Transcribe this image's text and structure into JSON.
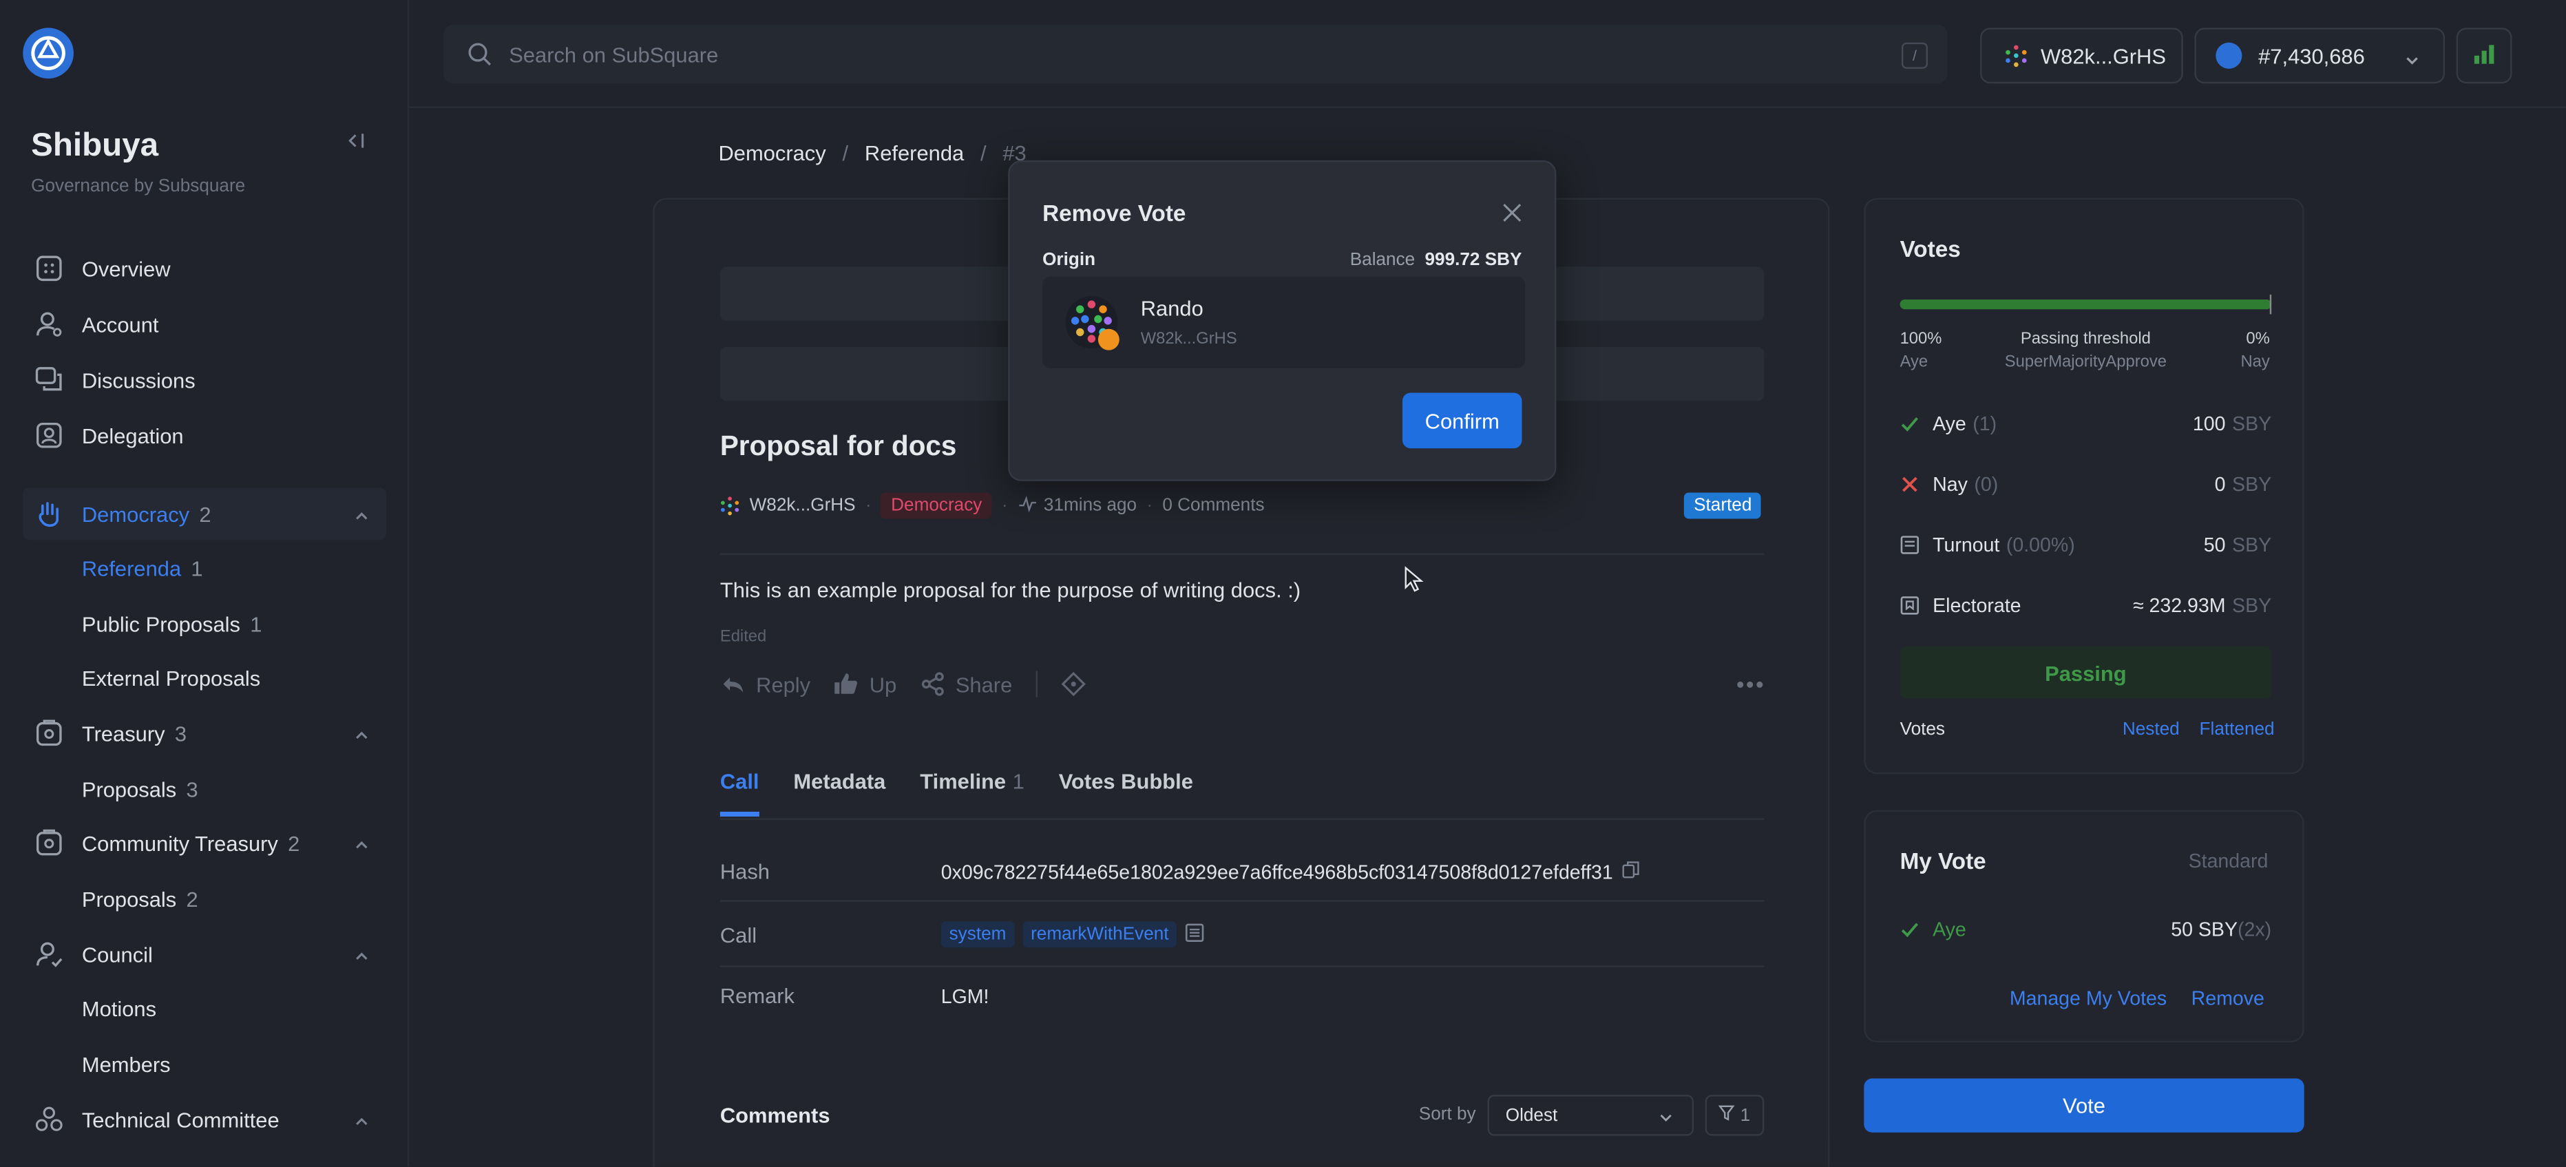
{
  "sidebar": {
    "chain_name": "Shibuya",
    "chain_sub": "Governance by Subsquare",
    "items": [
      {
        "label": "Overview",
        "icon": "overview-icon"
      },
      {
        "label": "Account",
        "icon": "account-icon"
      },
      {
        "label": "Discussions",
        "icon": "discussions-icon"
      },
      {
        "label": "Delegation",
        "icon": "delegation-icon"
      },
      {
        "label": "Democracy",
        "count": "2",
        "icon": "democracy-hand-icon"
      },
      {
        "label": "Treasury",
        "count": "3",
        "icon": "treasury-icon"
      },
      {
        "label": "Community Treasury",
        "count": "2",
        "icon": "community-treasury-icon"
      },
      {
        "label": "Council",
        "icon": "council-icon"
      },
      {
        "label": "Technical Committee",
        "icon": "technical-committee-icon"
      }
    ],
    "subs": {
      "referenda": {
        "label": "Referenda",
        "count": "1"
      },
      "public_proposals": {
        "label": "Public Proposals",
        "count": "1"
      },
      "external_proposals": {
        "label": "External Proposals"
      },
      "treasury_proposals": {
        "label": "Proposals",
        "count": "3"
      },
      "community_proposals": {
        "label": "Proposals",
        "count": "2"
      },
      "motions": {
        "label": "Motions"
      },
      "members": {
        "label": "Members"
      }
    }
  },
  "header": {
    "search_placeholder": "Search on SubSquare",
    "search_shortcut": "/",
    "account": "W82k...GrHS",
    "block": "#7,430,686"
  },
  "breadcrumb": {
    "a": "Democracy",
    "b": "Referenda",
    "c": "#3"
  },
  "post": {
    "title": "Proposal for docs",
    "author": "W82k...GrHS",
    "tag": "Democracy",
    "time": "31mins ago",
    "comments": "0 Comments",
    "status": "Started",
    "body": "This is an example proposal for the purpose of writing docs. :)",
    "edited": "Edited",
    "actions": {
      "reply": "Reply",
      "up": "Up",
      "share": "Share"
    }
  },
  "tabs": [
    {
      "label": "Call"
    },
    {
      "label": "Metadata"
    },
    {
      "label": "Timeline",
      "count": "1"
    },
    {
      "label": "Votes Bubble"
    }
  ],
  "call": {
    "hash_label": "Hash",
    "hash": "0x09c782275f44e65e1802a929ee7a6ffce4968b5cf03147508f8d0127efdeff31",
    "call_label": "Call",
    "section": "system",
    "method": "remarkWithEvent",
    "remark_label": "Remark",
    "remark": "LGM!"
  },
  "comments": {
    "title": "Comments",
    "sort_label": "Sort by",
    "sort_value": "Oldest",
    "filter_count": "1"
  },
  "votes": {
    "title": "Votes",
    "aye_pct": "100%",
    "aye_label": "Aye",
    "threshold_label": "Passing threshold",
    "threshold": "SuperMajorityApprove",
    "nay_pct": "0%",
    "nay_label": "Nay",
    "aye_row": {
      "label": "Aye",
      "count": "(1)",
      "value": "100",
      "unit": "SBY"
    },
    "nay_row": {
      "label": "Nay",
      "count": "(0)",
      "value": "0",
      "unit": "SBY"
    },
    "turnout_row": {
      "label": "Turnout",
      "count": "(0.00%)",
      "value": "50",
      "unit": "SBY"
    },
    "electorate_row": {
      "label": "Electorate",
      "value": "≈ 232.93M",
      "unit": "SBY"
    },
    "status": "Passing",
    "foot_label": "Votes",
    "nested": "Nested",
    "flattened": "Flattened"
  },
  "my_vote": {
    "title": "My Vote",
    "type": "Standard",
    "direction": "Aye",
    "amount": "50 SBY",
    "conviction": "(2x)",
    "manage": "Manage My Votes",
    "remove": "Remove"
  },
  "vote_button": "Vote",
  "modal": {
    "title": "Remove Vote",
    "origin": "Origin",
    "balance_label": "Balance",
    "balance": "999.72 SBY",
    "account_name": "Rando",
    "account_addr": "W82k...GrHS",
    "confirm": "Confirm"
  },
  "colors": {
    "accent": "#3b7ff0",
    "aye": "#3e9a48",
    "nay": "#e0524c",
    "tag": "#e04a6c"
  }
}
